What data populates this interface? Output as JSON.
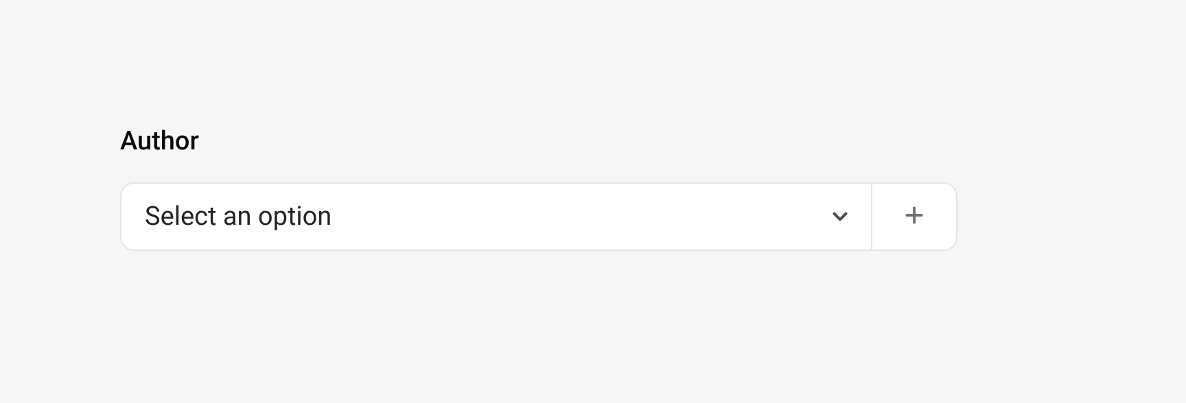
{
  "field": {
    "label": "Author",
    "placeholder": "Select an option"
  }
}
